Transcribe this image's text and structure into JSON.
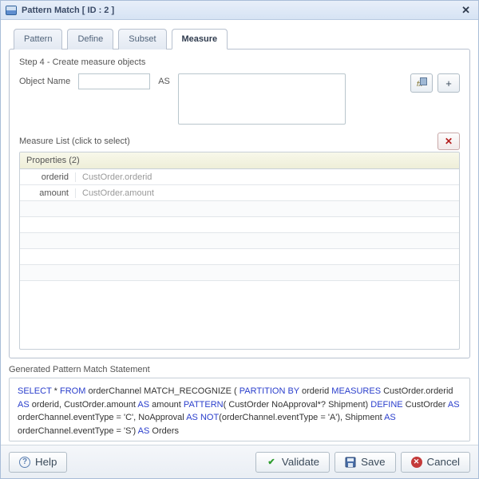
{
  "window": {
    "title": "Pattern Match [ ID : 2 ]",
    "close_tooltip": "Close"
  },
  "tabs": [
    {
      "id": "pattern",
      "label": "Pattern"
    },
    {
      "id": "define",
      "label": "Define"
    },
    {
      "id": "subset",
      "label": "Subset"
    },
    {
      "id": "measure",
      "label": "Measure"
    }
  ],
  "active_tab": "measure",
  "measure": {
    "step_title": "Step 4 - Create measure objects",
    "object_name_label": "Object Name",
    "object_name_value": "",
    "as_label": "AS",
    "as_value": "",
    "fx_button_tooltip": "Expression Builder",
    "add_button_label": "+",
    "list_label": "Measure List (click to select)",
    "delete_tooltip": "Delete",
    "grid_header": "Properties (2)",
    "rows": [
      {
        "name": "orderid",
        "value": "CustOrder.orderid"
      },
      {
        "name": "amount",
        "value": "CustOrder.amount"
      }
    ]
  },
  "generated": {
    "title": "Generated Pattern Match Statement",
    "tokens": [
      {
        "t": "SELECT",
        "k": true
      },
      {
        "t": " * ",
        "k": false
      },
      {
        "t": "FROM",
        "k": true
      },
      {
        "t": " orderChannel  MATCH_RECOGNIZE ( ",
        "k": false
      },
      {
        "t": "PARTITION BY",
        "k": true
      },
      {
        "t": " orderid ",
        "k": false
      },
      {
        "t": "MEASURES",
        "k": true
      },
      {
        "t": " CustOrder.orderid ",
        "k": false
      },
      {
        "t": "AS",
        "k": true
      },
      {
        "t": " orderid, CustOrder.amount ",
        "k": false
      },
      {
        "t": "AS",
        "k": true
      },
      {
        "t": " amount ",
        "k": false
      },
      {
        "t": "PATTERN",
        "k": true
      },
      {
        "t": "( CustOrder NoApproval*? Shipment) ",
        "k": false
      },
      {
        "t": "DEFINE",
        "k": true
      },
      {
        "t": " CustOrder ",
        "k": false
      },
      {
        "t": "AS",
        "k": true
      },
      {
        "t": " orderChannel.eventType = 'C', NoApproval ",
        "k": false
      },
      {
        "t": "AS",
        "k": true
      },
      {
        "t": " ",
        "k": false
      },
      {
        "t": "NOT",
        "k": true
      },
      {
        "t": "(orderChannel.eventType = 'A'), Shipment ",
        "k": false
      },
      {
        "t": "AS",
        "k": true
      },
      {
        "t": " orderChannel.eventType = 'S') ",
        "k": false
      },
      {
        "t": "AS",
        "k": true
      },
      {
        "t": " Orders",
        "k": false
      }
    ]
  },
  "buttons": {
    "help": "Help",
    "validate": "Validate",
    "save": "Save",
    "cancel": "Cancel"
  }
}
